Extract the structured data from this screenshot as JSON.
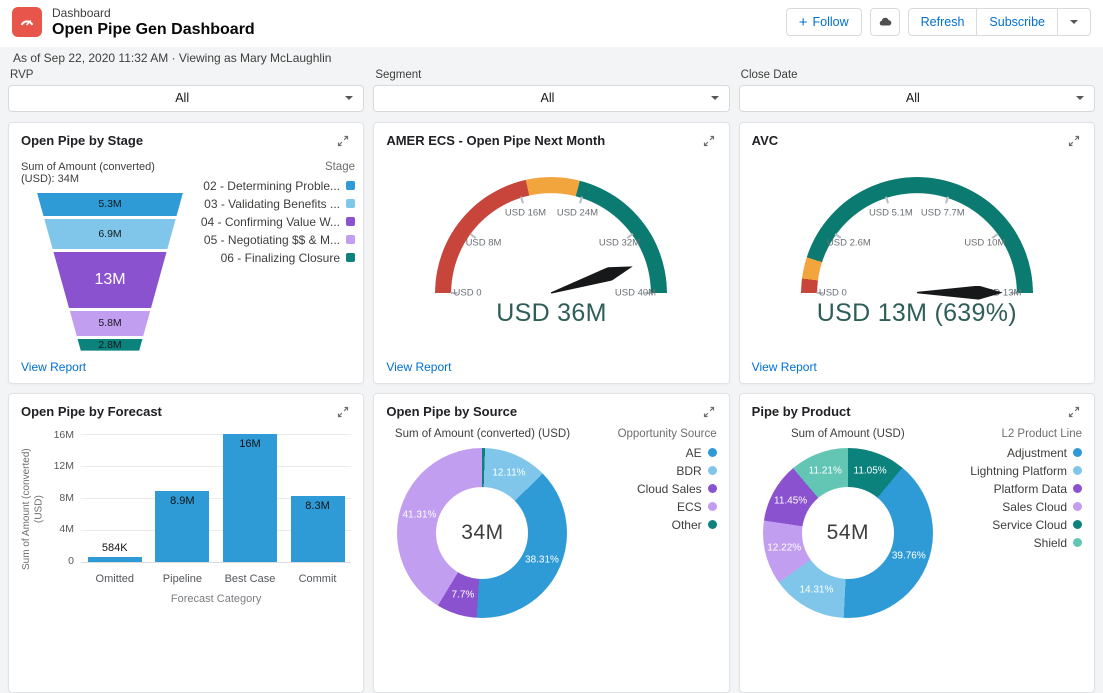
{
  "colors": {
    "accent_blue": "#0070d2",
    "dashboard_icon_bg": "#E8554A",
    "gauge_value_text": "#2F5E58",
    "page_background": "#F3F4F6"
  },
  "header": {
    "app_label": "Dashboard",
    "title": "Open Pipe Gen Dashboard",
    "meta": "As of Sep 22, 2020 11:32 AM · Viewing as Mary McLaughlin",
    "buttons": {
      "follow": "Follow",
      "refresh": "Refresh",
      "subscribe": "Subscribe"
    }
  },
  "filters": [
    {
      "label": "RVP",
      "value": "All"
    },
    {
      "label": "Segment",
      "value": "All"
    },
    {
      "label": "Close Date",
      "value": "All"
    }
  ],
  "view_report_label": "View Report",
  "chart_data": [
    {
      "type": "funnel",
      "title": "Open Pipe by Stage",
      "summary": "Sum of Amount (converted) (USD): 34M",
      "legend_title": "Stage",
      "segments": [
        {
          "label": "02 - Determining Proble...",
          "value": 5.3,
          "value_label": "5.3M",
          "color": "#2E9BD6"
        },
        {
          "label": "03 - Validating Benefits ...",
          "value": 6.9,
          "value_label": "6.9M",
          "color": "#7FC6EA"
        },
        {
          "label": "04 - Confirming Value W...",
          "value": 13,
          "value_label": "13M",
          "color": "#8A52CF"
        },
        {
          "label": "05 - Negotiating $$ & M...",
          "value": 5.8,
          "value_label": "5.8M",
          "color": "#C29EF1"
        },
        {
          "label": "06 - Finalizing Closure",
          "value": 2.8,
          "value_label": "2.8M",
          "color": "#0B827C"
        }
      ]
    },
    {
      "type": "gauge",
      "title": "AMER ECS - Open Pipe Next Month",
      "value": 36,
      "max": 40,
      "value_label": "USD 36M",
      "ticks": [
        "USD 0",
        "USD 8M",
        "USD 16M",
        "USD 24M",
        "USD 32M",
        "USD 40M"
      ],
      "bands": [
        {
          "end_frac": 0.43,
          "color": "#C8453C"
        },
        {
          "end_frac": 0.58,
          "color": "#F2A53C"
        },
        {
          "end_frac": 1,
          "color": "#0B7A70"
        }
      ]
    },
    {
      "type": "gauge",
      "title": "AVC",
      "value": 13,
      "max": 13,
      "value_label": "USD 13M (639%)",
      "ticks": [
        "USD 0",
        "USD 2.6M",
        "USD 5.1M",
        "USD 7.7M",
        "USD 10M",
        "USD 13M"
      ],
      "bands": [
        {
          "end_frac": 0.04,
          "color": "#C8453C"
        },
        {
          "end_frac": 0.1,
          "color": "#F2A53C"
        },
        {
          "end_frac": 1,
          "color": "#0B7A70"
        }
      ]
    },
    {
      "type": "bar",
      "title": "Open Pipe by Forecast",
      "ylabel": "Sum of Amount (converted) (USD)",
      "xlabel": "Forecast Category",
      "categories": [
        "Omitted",
        "Pipeline",
        "Best Case",
        "Commit"
      ],
      "values": [
        0.584,
        8.9,
        16,
        8.3
      ],
      "value_labels": [
        "584K",
        "8.9M",
        "16M",
        "8.3M"
      ],
      "y_ticks": [
        "16M",
        "12M",
        "8M",
        "4M",
        "0"
      ],
      "ylim": [
        0,
        16
      ],
      "bar_color": "#2E9BD6"
    },
    {
      "type": "pie",
      "title": "Open Pipe by Source",
      "subtitle": "Sum of Amount (converted) (USD)",
      "center_label": "34M",
      "legend_title": "Opportunity Source",
      "legend": [
        {
          "label": "AE",
          "color": "#2E9BD6"
        },
        {
          "label": "BDR",
          "color": "#7FC6EA"
        },
        {
          "label": "Cloud Sales",
          "color": "#8A52CF"
        },
        {
          "label": "ECS",
          "color": "#C29EF1"
        },
        {
          "label": "Other",
          "color": "#0B827C"
        }
      ],
      "slices": [
        {
          "label": "Other",
          "value": 0.57,
          "pct_label": "",
          "color": "#0B827C"
        },
        {
          "label": "BDR",
          "value": 12.11,
          "pct_label": "12.11%",
          "color": "#7FC6EA"
        },
        {
          "label": "AE",
          "value": 38.31,
          "pct_label": "38.31%",
          "color": "#2E9BD6"
        },
        {
          "label": "Cloud Sales",
          "value": 7.7,
          "pct_label": "7.7%",
          "color": "#8A52CF"
        },
        {
          "label": "ECS",
          "value": 41.31,
          "pct_label": "41.31%",
          "color": "#C29EF1"
        }
      ]
    },
    {
      "type": "pie",
      "title": "Pipe by Product",
      "subtitle": "Sum of Amount (USD)",
      "center_label": "54M",
      "legend_title": "L2 Product Line",
      "legend": [
        {
          "label": "Adjustment",
          "color": "#2E9BD6"
        },
        {
          "label": "Lightning Platform",
          "color": "#7FC6EA"
        },
        {
          "label": "Platform Data",
          "color": "#8A52CF"
        },
        {
          "label": "Sales Cloud",
          "color": "#C29EF1"
        },
        {
          "label": "Service Cloud",
          "color": "#0B827C"
        },
        {
          "label": "Shield",
          "color": "#63C6B5"
        }
      ],
      "slices": [
        {
          "label": "Service Cloud",
          "value": 11.05,
          "pct_label": "11.05%",
          "color": "#0B827C"
        },
        {
          "label": "Adjustment",
          "value": 39.76,
          "pct_label": "39.76%",
          "color": "#2E9BD6"
        },
        {
          "label": "Lightning Platform",
          "value": 14.31,
          "pct_label": "14.31%",
          "color": "#7FC6EA"
        },
        {
          "label": "Sales Cloud",
          "value": 12.22,
          "pct_label": "12.22%",
          "color": "#C29EF1"
        },
        {
          "label": "Platform Data",
          "value": 11.45,
          "pct_label": "11.45%",
          "color": "#8A52CF"
        },
        {
          "label": "Shield",
          "value": 11.21,
          "pct_label": "11.21%",
          "color": "#63C6B5"
        }
      ]
    }
  ]
}
